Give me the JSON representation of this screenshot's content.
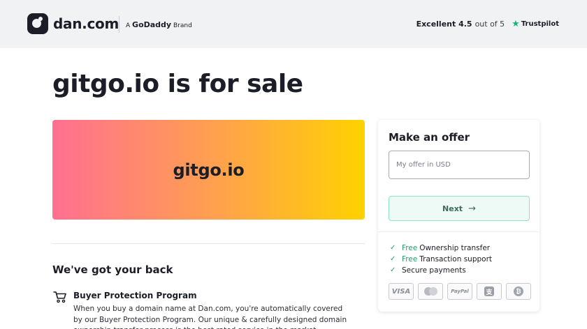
{
  "header": {
    "logo_text": "dan.com",
    "brand_prefix": "A",
    "brand_name": "GoDaddy",
    "brand_suffix": "Brand",
    "trust_rating": "Excellent 4.5",
    "trust_out_of": "out of 5",
    "trust_star_icon": "star-icon",
    "trust_label": "Trustpilot"
  },
  "main": {
    "title_domain": "gitgo.io",
    "title_rest": "is for sale",
    "banner_domain": "gitgo.io",
    "section_title": "We've got your back",
    "feature": {
      "icon": "cart-icon",
      "title": "Buyer Protection Program",
      "text": "When you buy a domain name at Dan.com, you're automatically covered by our Buyer Protection Program. Our unique & carefully designed domain ownership transfer process is the best rated service in the market."
    }
  },
  "offer": {
    "title": "Make an offer",
    "input_placeholder": "My offer in USD",
    "input_value": "",
    "next_label": "Next",
    "perks": [
      {
        "free": "Free",
        "text": "Ownership transfer"
      },
      {
        "free": "Free",
        "text": "Transaction support"
      },
      {
        "free": "",
        "text": "Secure payments"
      }
    ],
    "payment_methods": [
      "VISA",
      "mastercard",
      "PayPal",
      "alipay",
      "bitcoin"
    ],
    "payment_labels": {
      "visa": "VISA",
      "paypal": "PayPal",
      "alipay": "支",
      "bitcoin": "₿"
    }
  },
  "colors": {
    "accent_green": "#1f9d6b",
    "banner_gradient": [
      "#ff6f91",
      "#ffa34a",
      "#ffd200"
    ],
    "header_bg": "#f1f2f4",
    "trustpilot_star": "#19b37b"
  }
}
